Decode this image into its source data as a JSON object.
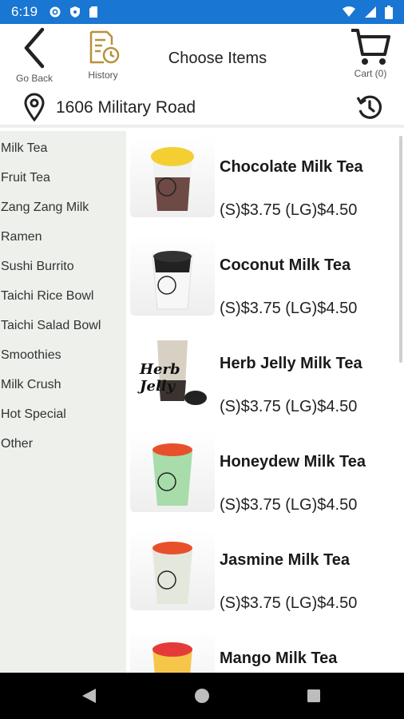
{
  "status_bar": {
    "time": "6:19"
  },
  "header": {
    "back_label": "Go Back",
    "history_label": "History",
    "title": "Choose Items",
    "cart_label": "Cart (0)"
  },
  "address": {
    "text": "1606 Military Road"
  },
  "categories": [
    "Milk Tea",
    "Fruit Tea",
    "Zang Zang Milk",
    "Ramen",
    "Sushi Burrito",
    "Taichi Rice Bowl",
    "Taichi Salad Bowl",
    "Smoothies",
    "Milk Crush",
    "Hot Special",
    "Other"
  ],
  "items": [
    {
      "name": "Chocolate Milk Tea",
      "price": "(S)$3.75 (LG)$4.50"
    },
    {
      "name": "Coconut Milk Tea",
      "price": "(S)$3.75 (LG)$4.50"
    },
    {
      "name": "Herb Jelly Milk Tea",
      "price": "(S)$3.75 (LG)$4.50",
      "image_text": "Herb Jelly"
    },
    {
      "name": "Honeydew Milk Tea",
      "price": "(S)$3.75 (LG)$4.50"
    },
    {
      "name": "Jasmine Milk Tea",
      "price": "(S)$3.75 (LG)$4.50"
    },
    {
      "name": "Mango Milk Tea",
      "price": ""
    }
  ],
  "colors": {
    "status_bar": "#1976d2",
    "sidebar_bg": "#eef0ec",
    "history_icon": "#b8913a"
  }
}
